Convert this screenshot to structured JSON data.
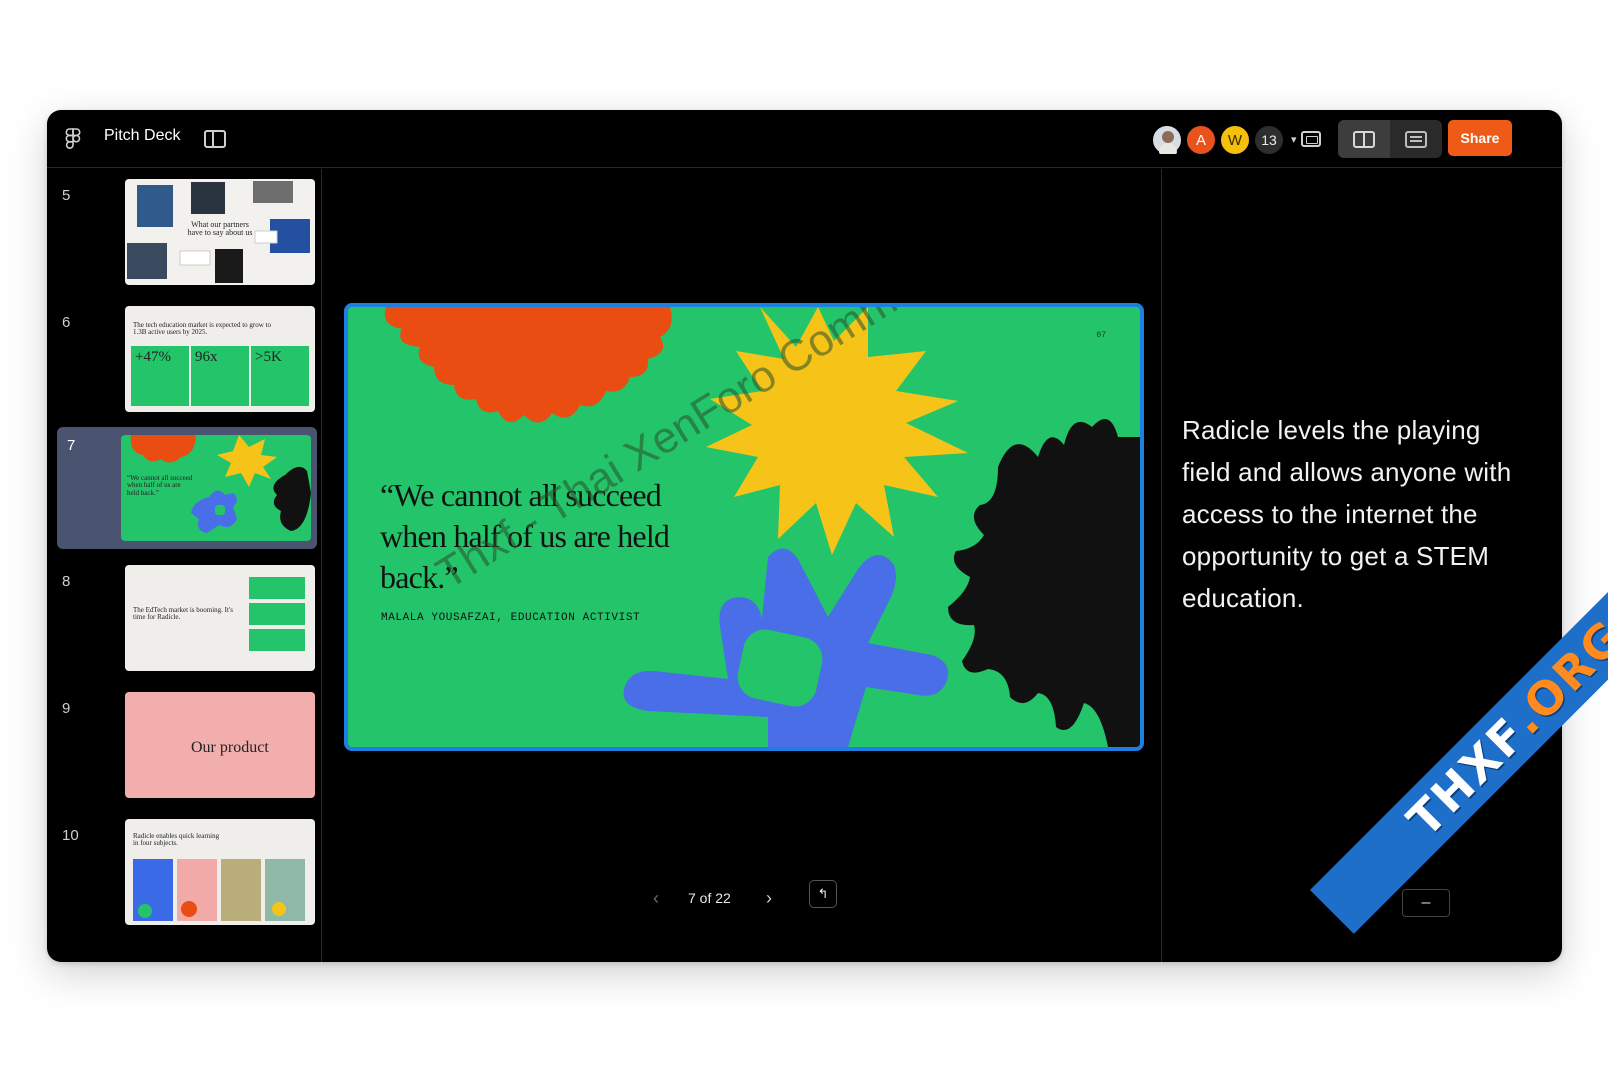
{
  "app": {
    "title": "Pitch Deck"
  },
  "collaborators": {
    "a": "A",
    "w": "W",
    "count": "13"
  },
  "toolbar": {
    "share_label": "Share"
  },
  "thumbnails": [
    {
      "num": "5",
      "caption": "What our partners have to say about us"
    },
    {
      "num": "6",
      "caption": "The tech education market is expected to grow to 1.3B active users by 2025.",
      "stats": [
        "+47%",
        "96x",
        ">5K"
      ]
    },
    {
      "num": "7",
      "caption": "“We cannot all succeed when half of us are held back.”"
    },
    {
      "num": "8",
      "caption": "The EdTech market is booming. It's time for Radicle."
    },
    {
      "num": "9",
      "caption": "Our product"
    },
    {
      "num": "10",
      "caption": "Radicle enables quick learning in four subjects."
    }
  ],
  "slide": {
    "quote": "“We cannot all succeed when half of us are held back.”",
    "attribution": "MALALA YOUSAFZAI, EDUCATION ACTIVIST",
    "number": "07",
    "watermark": "Thxf - Thai XenForo Community"
  },
  "pager": {
    "indicator": "7 of 22"
  },
  "notes": {
    "text": "Radicle levels the playing field and allows anyone with access to the internet the opportunity to get a STEM education."
  },
  "ribbon": {
    "main": "THXF",
    "suffix": ".ORG"
  },
  "colors": {
    "accent": "#ef5a17",
    "slide_border": "#1d7fe0",
    "slide_bg": "#24c46a",
    "selected_row": "#4a5370"
  }
}
